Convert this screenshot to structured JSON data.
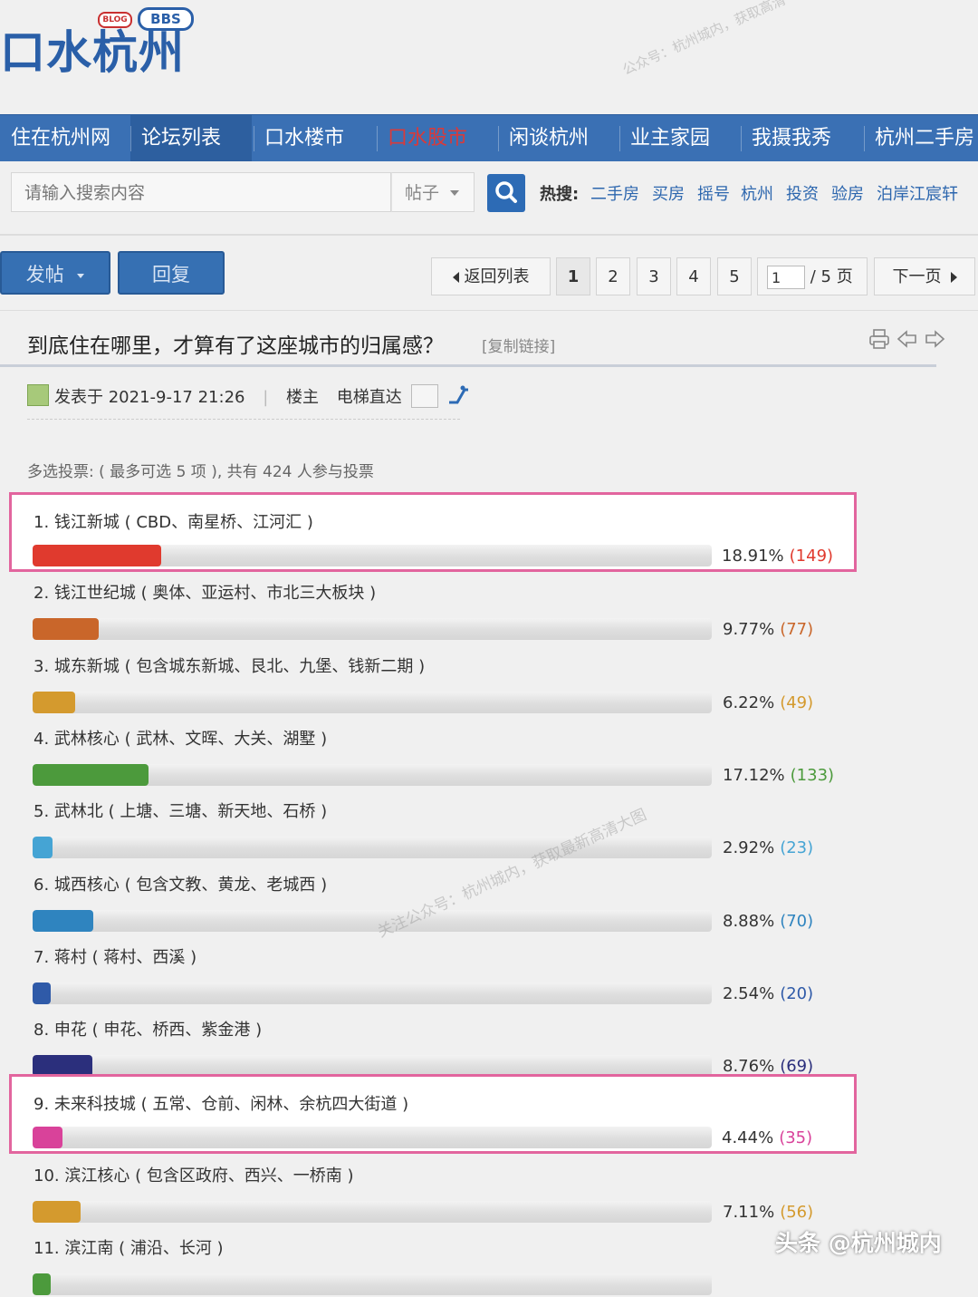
{
  "header": {
    "logo_text": "口水杭州",
    "logo_badge_bbs": "BBS",
    "logo_badge_blog": "BLOG",
    "watermark_top": "公众号：杭州城内，获取高清",
    "watermark_mid": "关注公众号：杭州城内，获取最新高清大图"
  },
  "nav": {
    "items": [
      {
        "label": "住在杭州网",
        "active": false
      },
      {
        "label": "论坛列表",
        "active": true
      },
      {
        "label": "口水楼市",
        "active": false
      },
      {
        "label": "口水股市",
        "active": false,
        "color": "#d93a3a"
      },
      {
        "label": "闲谈杭州",
        "active": false
      },
      {
        "label": "业主家园",
        "active": false
      },
      {
        "label": "我摄我秀",
        "active": false
      },
      {
        "label": "杭州二手房",
        "active": false
      }
    ]
  },
  "search": {
    "placeholder": "请输入搜索内容",
    "type_select": "帖子",
    "hot_label": "热搜:",
    "hot_terms": [
      "二手房",
      "买房",
      "摇号",
      "杭州",
      "投资",
      "验房",
      "泊岸江宸轩"
    ]
  },
  "actions": {
    "post_label": "发帖",
    "reply_label": "回复"
  },
  "pagination": {
    "back_label": "返回列表",
    "pages": [
      "1",
      "2",
      "3",
      "4",
      "5"
    ],
    "current": "1",
    "input_value": "1",
    "total_label": "/ 5 页",
    "next_label": "下一页"
  },
  "post": {
    "title": "到底住在哪里，才算有了这座城市的归属感？",
    "copy_link": "[复制链接]",
    "posted_at": "发表于 2021-9-17 21:26",
    "separator": "|",
    "role": "楼主",
    "elevator_label": "电梯直达"
  },
  "poll": {
    "header": "多选投票: ( 最多可选 5 项 ), 共有 424 人参与投票",
    "options": [
      {
        "label": "1.  钱江新城 ( CBD、南星桥、江河汇 )",
        "percent_text": "18.91%",
        "count_text": "(149)",
        "percent": 18.91,
        "color": "#e03a2e",
        "highlight": true
      },
      {
        "label": "2.  钱江世纪城 ( 奥体、亚运村、市北三大板块 )",
        "percent_text": "9.77%",
        "count_text": "(77)",
        "percent": 9.77,
        "color": "#c9662a",
        "highlight": false
      },
      {
        "label": "3.  城东新城 ( 包含城东新城、艮北、九堡、钱新二期 )",
        "percent_text": "6.22%",
        "count_text": "(49)",
        "percent": 6.22,
        "color": "#d49a2e",
        "highlight": false
      },
      {
        "label": "4.  武林核心 ( 武林、文晖、大关、湖墅 )",
        "percent_text": "17.12%",
        "count_text": "(133)",
        "percent": 17.12,
        "color": "#4c9a3c",
        "highlight": false
      },
      {
        "label": "5.  武林北 ( 上塘、三塘、新天地、石桥 )",
        "percent_text": "2.92%",
        "count_text": "(23)",
        "percent": 2.92,
        "color": "#45a4d4",
        "highlight": false
      },
      {
        "label": "6.  城西核心 ( 包含文教、黄龙、老城西 )",
        "percent_text": "8.88%",
        "count_text": "(70)",
        "percent": 8.88,
        "color": "#2f84bf",
        "highlight": false
      },
      {
        "label": "7.  蒋村 ( 蒋村、西溪 )",
        "percent_text": "2.54%",
        "count_text": "(20)",
        "percent": 2.54,
        "color": "#2f5aa8",
        "highlight": false
      },
      {
        "label": "8.  申花 ( 申花、桥西、紫金港 )",
        "percent_text": "8.76%",
        "count_text": "(69)",
        "percent": 8.76,
        "color": "#2b2f7c",
        "highlight": false
      },
      {
        "label": "9.  未来科技城 ( 五常、仓前、闲林、余杭四大街道 )",
        "percent_text": "4.44%",
        "count_text": "(35)",
        "percent": 4.44,
        "color": "#d9429a",
        "highlight": true
      },
      {
        "label": "10.  滨江核心 ( 包含区政府、西兴、一桥南 )",
        "percent_text": "7.11%",
        "count_text": "(56)",
        "percent": 7.11,
        "color": "#d49a2e",
        "highlight": false
      },
      {
        "label": "11.  滨江南 ( 浦沿、长河 )",
        "percent_text": "",
        "count_text": "",
        "percent": 2.0,
        "color": "#4c9a3c",
        "highlight": false
      }
    ]
  },
  "credit": "头条 @杭州城内"
}
